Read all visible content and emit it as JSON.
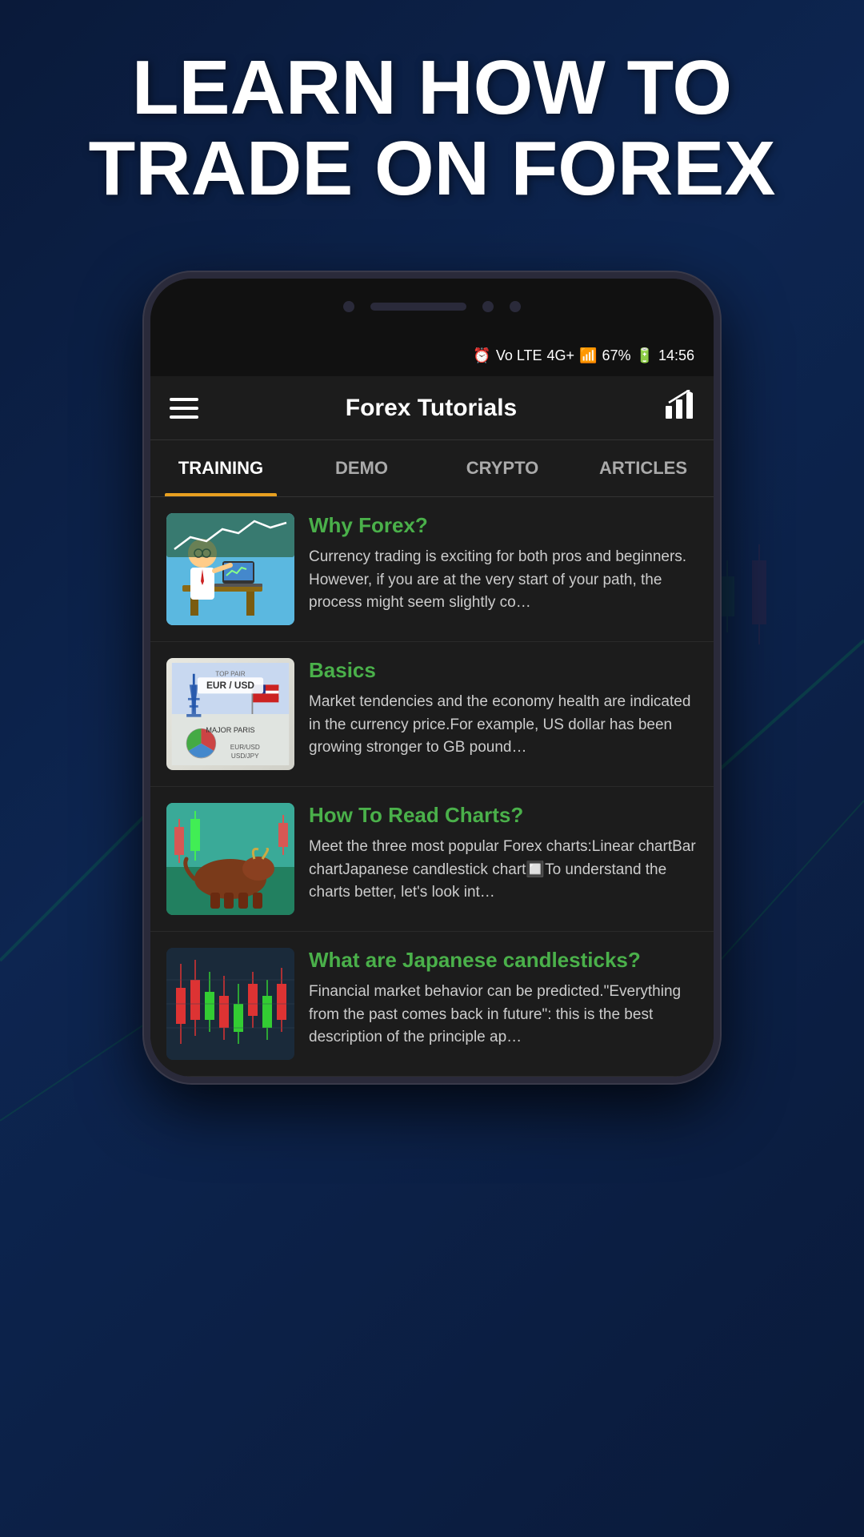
{
  "hero": {
    "title": "LEARN HOW TO TRADE ON FOREX"
  },
  "status_bar": {
    "time": "14:56",
    "battery": "67%",
    "network": "4G+",
    "signal": "Vo LTE"
  },
  "app_header": {
    "title": "Forex Tutorials"
  },
  "tabs": [
    {
      "label": "TRAINING",
      "active": true
    },
    {
      "label": "DEMO",
      "active": false
    },
    {
      "label": "CRYPTO",
      "active": false
    },
    {
      "label": "ARTICLES",
      "active": false
    }
  ],
  "articles": [
    {
      "title": "Why Forex?",
      "description": "Currency trading is exciting for both pros and beginners. However, if you are at the very start of your path, the process might seem slightly co…",
      "thumb_type": "why-forex"
    },
    {
      "title": "Basics",
      "description": "Market tendencies and the economy health are indicated in the currency price.For example, US dollar has been growing stronger to GB pound…",
      "thumb_type": "basics"
    },
    {
      "title": "How To Read Charts?",
      "description": "Meet the three most popular Forex charts:Linear chartBar chartJapanese candlestick chart🔲To understand the charts better, let's look int…",
      "thumb_type": "charts"
    },
    {
      "title": "What are Japanese candlesticks?",
      "description": "Financial market behavior can be predicted.\"Everything from the past comes back in future\": this is the best description of the principle ap…",
      "thumb_type": "candles"
    }
  ]
}
